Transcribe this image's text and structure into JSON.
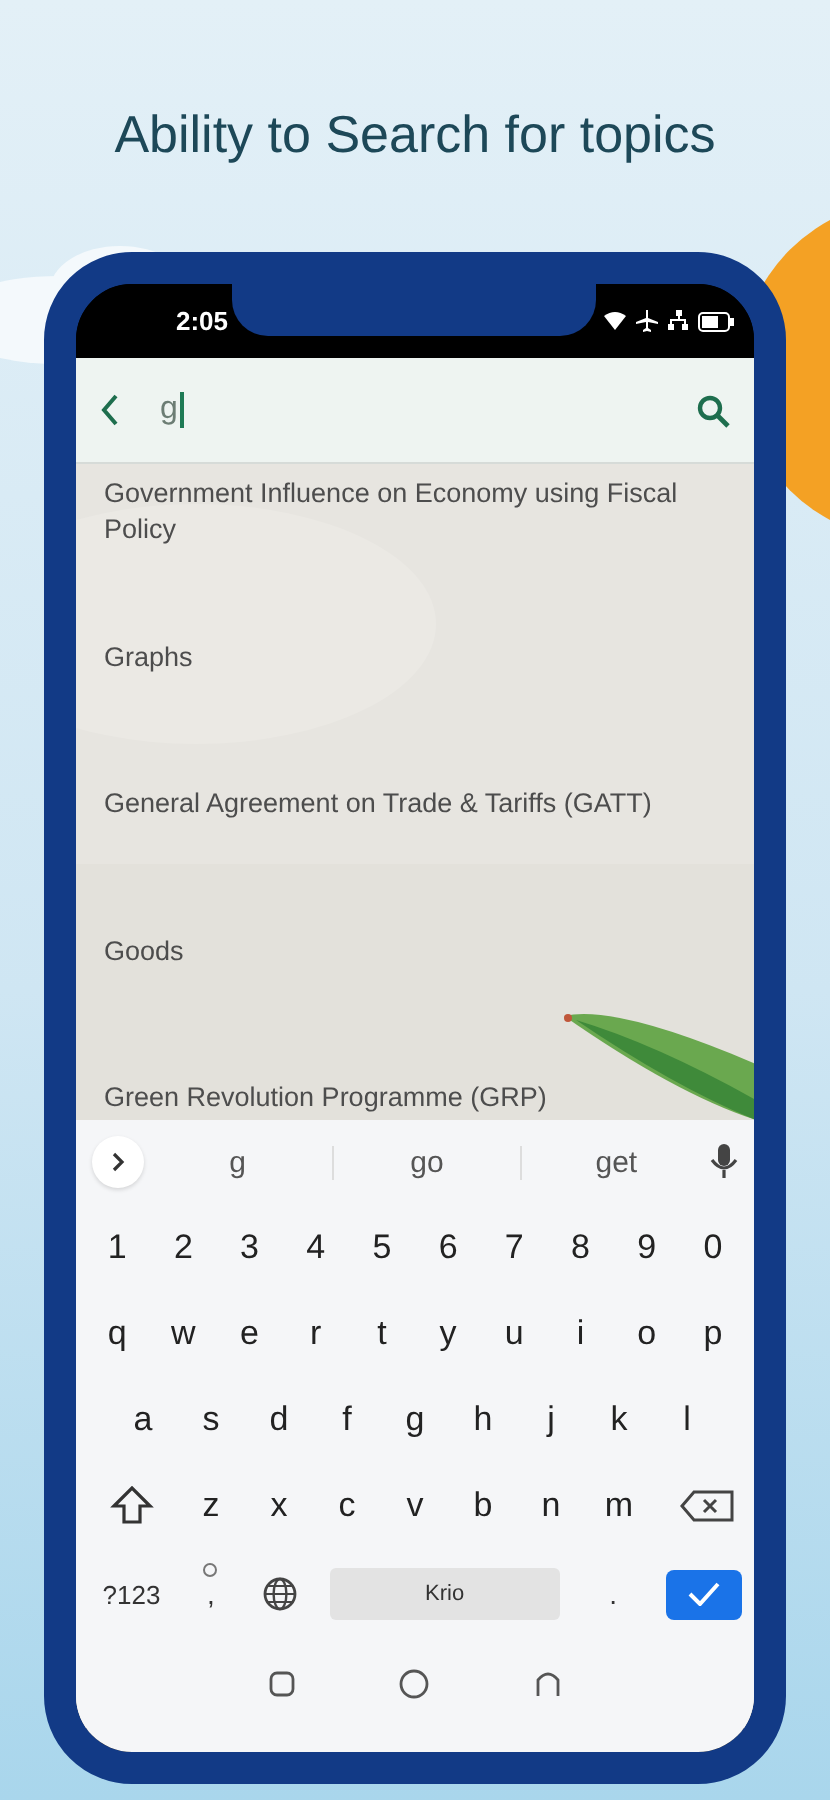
{
  "headline": "Ability to Search for topics",
  "status_bar": {
    "time": "2:05"
  },
  "search": {
    "value": "g"
  },
  "results": [
    {
      "title": "Government Influence on Economy using Fiscal Policy"
    },
    {
      "title": "Graphs"
    },
    {
      "title": "General Agreement on Trade & Tariffs (GATT)"
    },
    {
      "title": "Goods"
    },
    {
      "title": "Green Revolution Programme (GRP)"
    }
  ],
  "keyboard": {
    "suggestions": [
      "g",
      "go",
      "get"
    ],
    "rows": [
      [
        "1",
        "2",
        "3",
        "4",
        "5",
        "6",
        "7",
        "8",
        "9",
        "0"
      ],
      [
        "q",
        "w",
        "e",
        "r",
        "t",
        "y",
        "u",
        "i",
        "o",
        "p"
      ],
      [
        "a",
        "s",
        "d",
        "f",
        "g",
        "h",
        "j",
        "k",
        "l"
      ],
      [
        "z",
        "x",
        "c",
        "v",
        "b",
        "n",
        "m"
      ]
    ],
    "symbols_key": "?123",
    "comma_key": ",",
    "space_key": "Krio",
    "period_key": "."
  }
}
